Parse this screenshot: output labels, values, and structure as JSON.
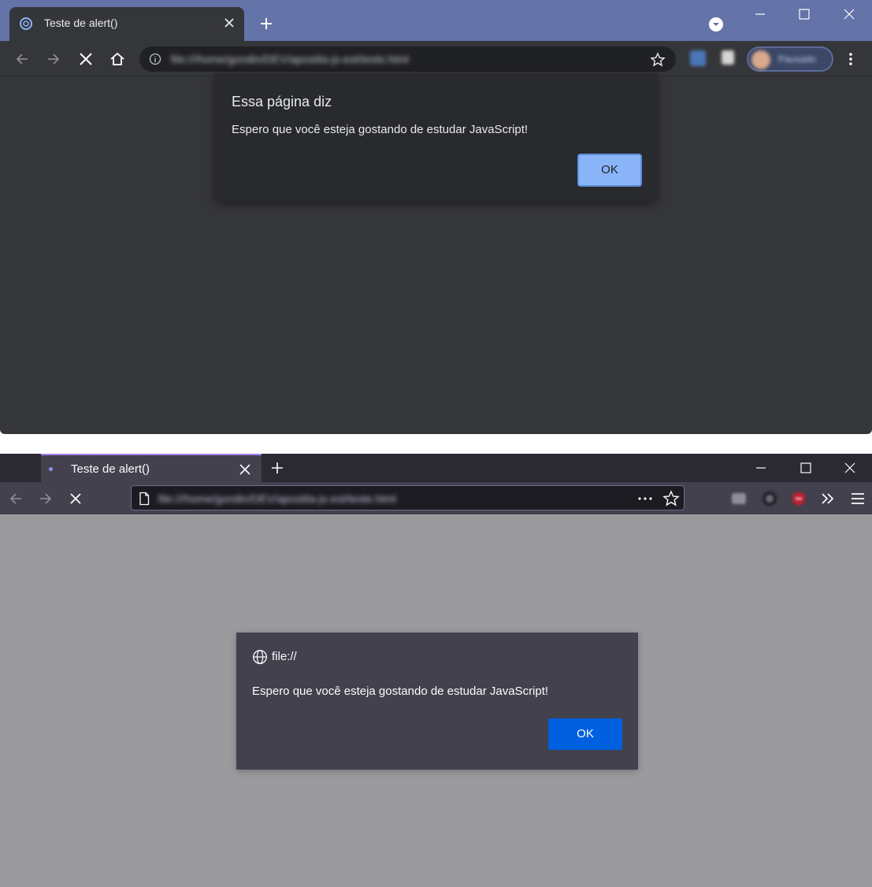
{
  "chrome": {
    "tab_title": "Teste de alert()",
    "url": "file:///home/gondin/DEV/apostila-js-est/teste.html",
    "profile_name": "Pausado",
    "dialog": {
      "title": "Essa página diz",
      "message": "Espero que você esteja gostando de estudar JavaScript!",
      "ok_label": "OK"
    },
    "colors": {
      "titlebar": "#6473a8",
      "toolbar": "#35363a",
      "dialog": "#292a2d",
      "ok": "#8ab4f8"
    }
  },
  "firefox": {
    "tab_title": "Teste de alert()",
    "url": "file:///home/gondin/DEV/apostila-js-est/teste.html",
    "dialog": {
      "origin": "file://",
      "message": "Espero que você esteja gostando de estudar JavaScript!",
      "ok_label": "OK"
    },
    "colors": {
      "titlebar": "#2b2a33",
      "toolbar": "#42414d",
      "dialog": "#42414d",
      "ok": "#0060df",
      "content": "#9b9b9e"
    }
  }
}
